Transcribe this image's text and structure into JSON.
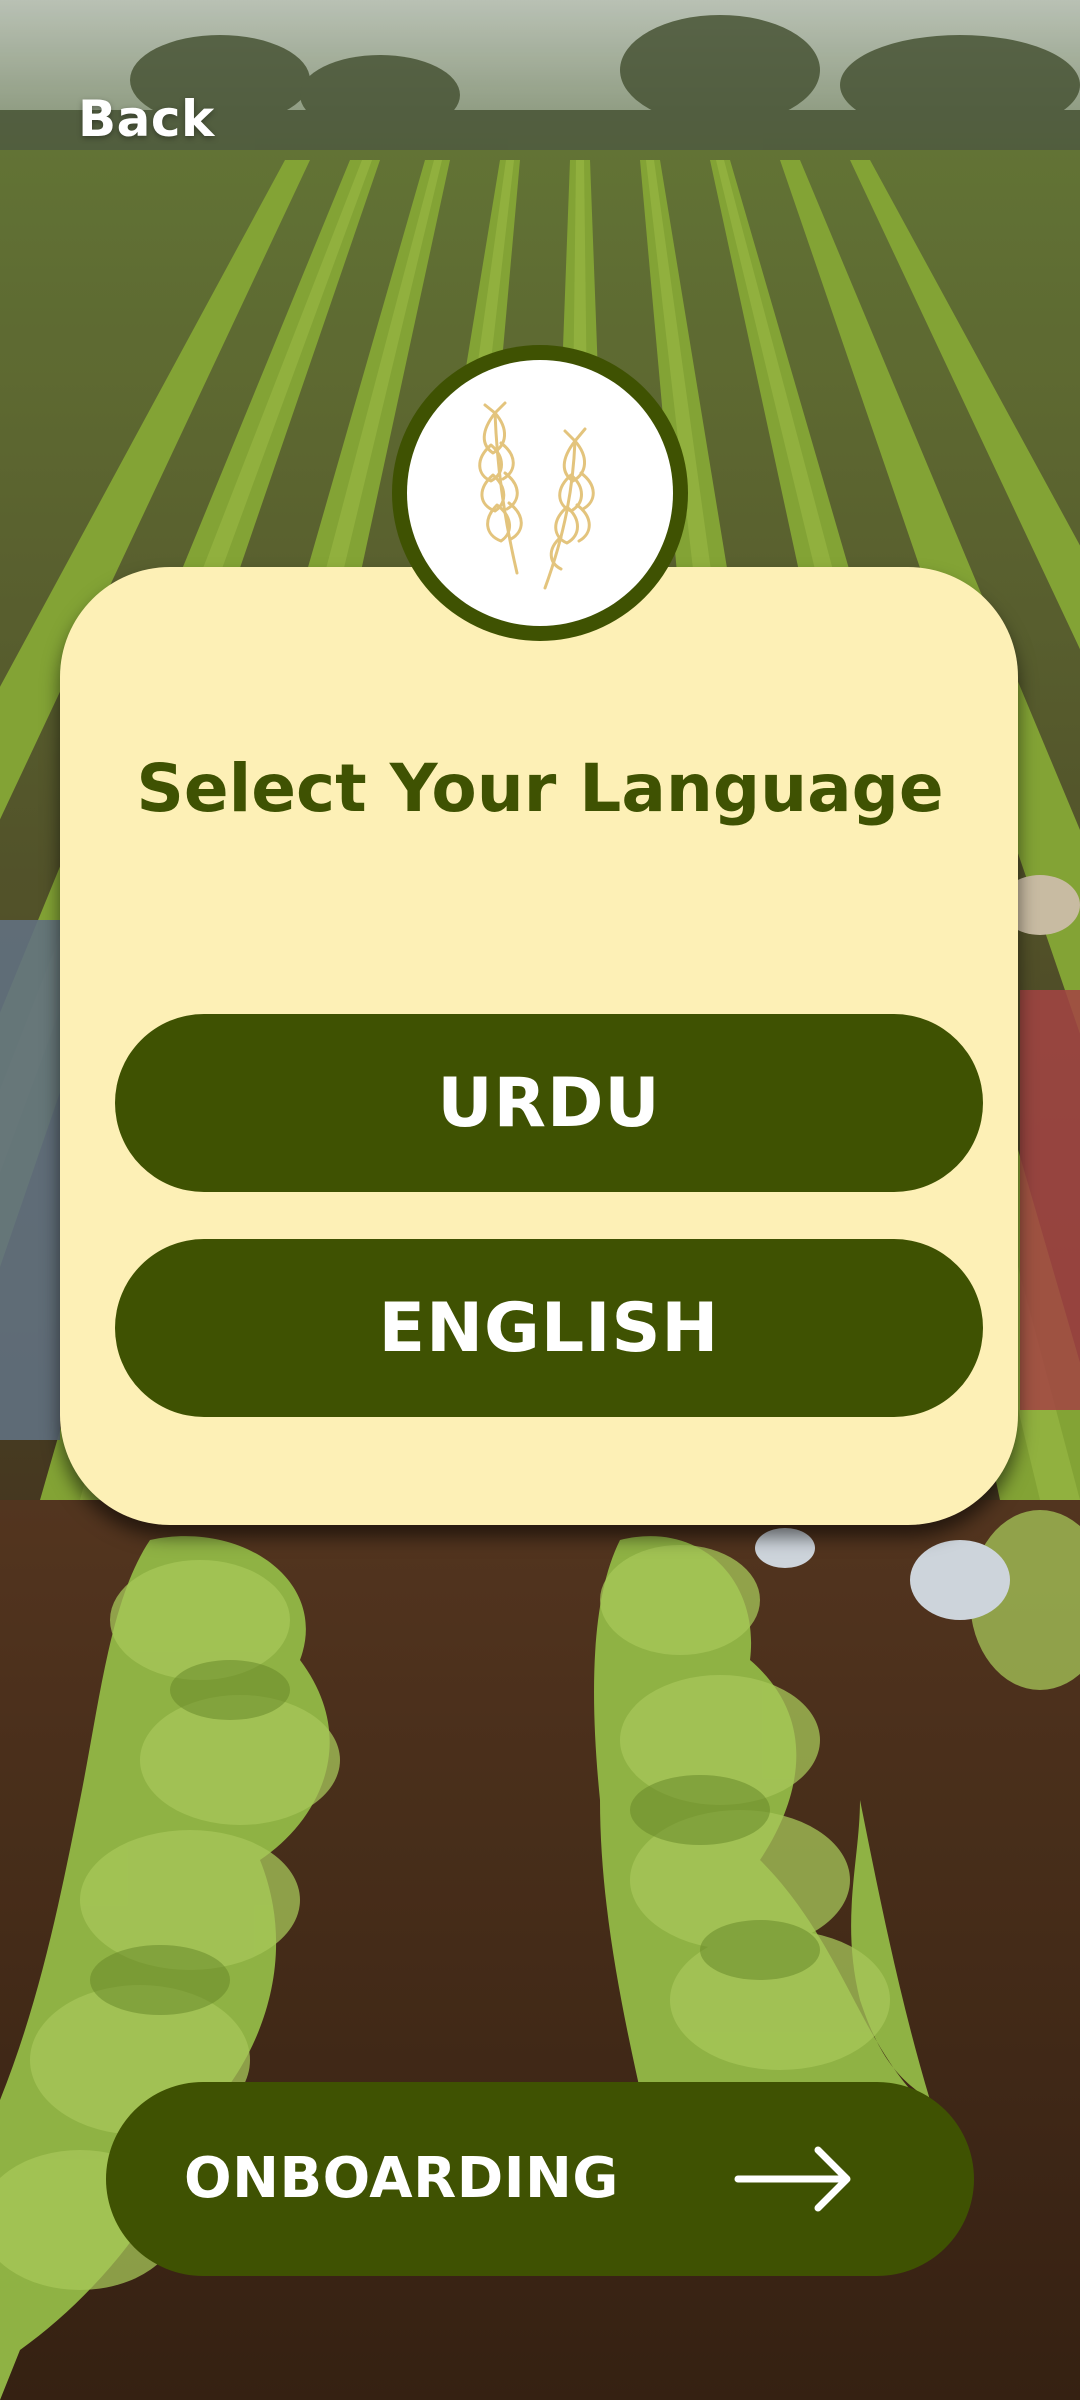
{
  "nav": {
    "back_label": "Back"
  },
  "logo": {
    "icon": "wheat-icon"
  },
  "language_card": {
    "title": "Select Your Language",
    "options": [
      {
        "label": "URDU"
      },
      {
        "label": "ENGLISH"
      }
    ]
  },
  "footer": {
    "onboarding_label": "ONBOARDING",
    "arrow_icon": "arrow-right-icon"
  },
  "colors": {
    "primary_green": "#3f5202",
    "card_background": "#fdf0b6",
    "wheat_gold": "#e3c47d",
    "text_on_primary": "#ffffff"
  }
}
